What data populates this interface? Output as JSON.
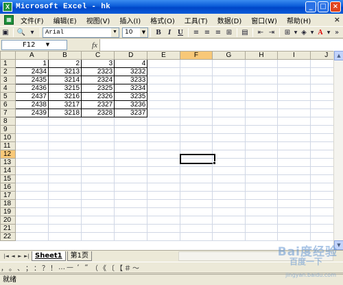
{
  "window": {
    "title": "Microsoft Excel - hk",
    "app_icon": "X",
    "minimize_symbol": "_",
    "maximize_symbol": "□",
    "close_symbol": "×"
  },
  "menu": {
    "items": [
      "文件(F)",
      "编辑(E)",
      "视图(V)",
      "插入(I)",
      "格式(O)",
      "工具(T)",
      "数据(D)",
      "窗口(W)",
      "帮助(H)"
    ],
    "close_symbol": "×"
  },
  "toolbar": {
    "font": "Arial",
    "size": "10",
    "bold": "B",
    "italic": "I",
    "underline": "U",
    "font_color": "A"
  },
  "formula_bar": {
    "name_box": "F12",
    "fx": "fx",
    "value": ""
  },
  "grid": {
    "columns": [
      "A",
      "B",
      "C",
      "D",
      "E",
      "F",
      "G",
      "H",
      "I",
      "J"
    ],
    "selected_column": "F",
    "selected_row": "12",
    "rows": [
      {
        "n": "1",
        "cells": [
          "1",
          "2",
          "3",
          "4"
        ]
      },
      {
        "n": "2",
        "cells": [
          "2434",
          "3213",
          "2323",
          "3232"
        ]
      },
      {
        "n": "3",
        "cells": [
          "2435",
          "3214",
          "2324",
          "3233"
        ]
      },
      {
        "n": "4",
        "cells": [
          "2436",
          "3215",
          "2325",
          "3234"
        ]
      },
      {
        "n": "5",
        "cells": [
          "2437",
          "3216",
          "2326",
          "3235"
        ]
      },
      {
        "n": "6",
        "cells": [
          "2438",
          "3217",
          "2327",
          "3236"
        ]
      },
      {
        "n": "7",
        "cells": [
          "2439",
          "3218",
          "2328",
          "3237"
        ]
      },
      {
        "n": "8",
        "cells": []
      },
      {
        "n": "9",
        "cells": []
      },
      {
        "n": "10",
        "cells": []
      },
      {
        "n": "11",
        "cells": []
      },
      {
        "n": "12",
        "cells": []
      },
      {
        "n": "13",
        "cells": []
      },
      {
        "n": "14",
        "cells": []
      },
      {
        "n": "15",
        "cells": []
      },
      {
        "n": "16",
        "cells": []
      },
      {
        "n": "17",
        "cells": []
      },
      {
        "n": "18",
        "cells": []
      },
      {
        "n": "19",
        "cells": []
      },
      {
        "n": "20",
        "cells": []
      },
      {
        "n": "21",
        "cells": []
      },
      {
        "n": "22",
        "cells": []
      }
    ]
  },
  "sheets": {
    "nav": [
      "|◄",
      "◄",
      "►",
      "►|"
    ],
    "tabs": [
      "Sheet1",
      "第1页"
    ]
  },
  "symbols": [
    "，",
    "。",
    "、",
    "；",
    "：",
    "？",
    "！",
    "…",
    "—",
    "‘",
    "“",
    "（",
    "《",
    "〔",
    "【",
    "＃",
    "～"
  ],
  "status": "就绪",
  "watermark": {
    "brand": "Bai度经验",
    "sub": "百度一下",
    "url": "jingyan.baidu.com"
  }
}
